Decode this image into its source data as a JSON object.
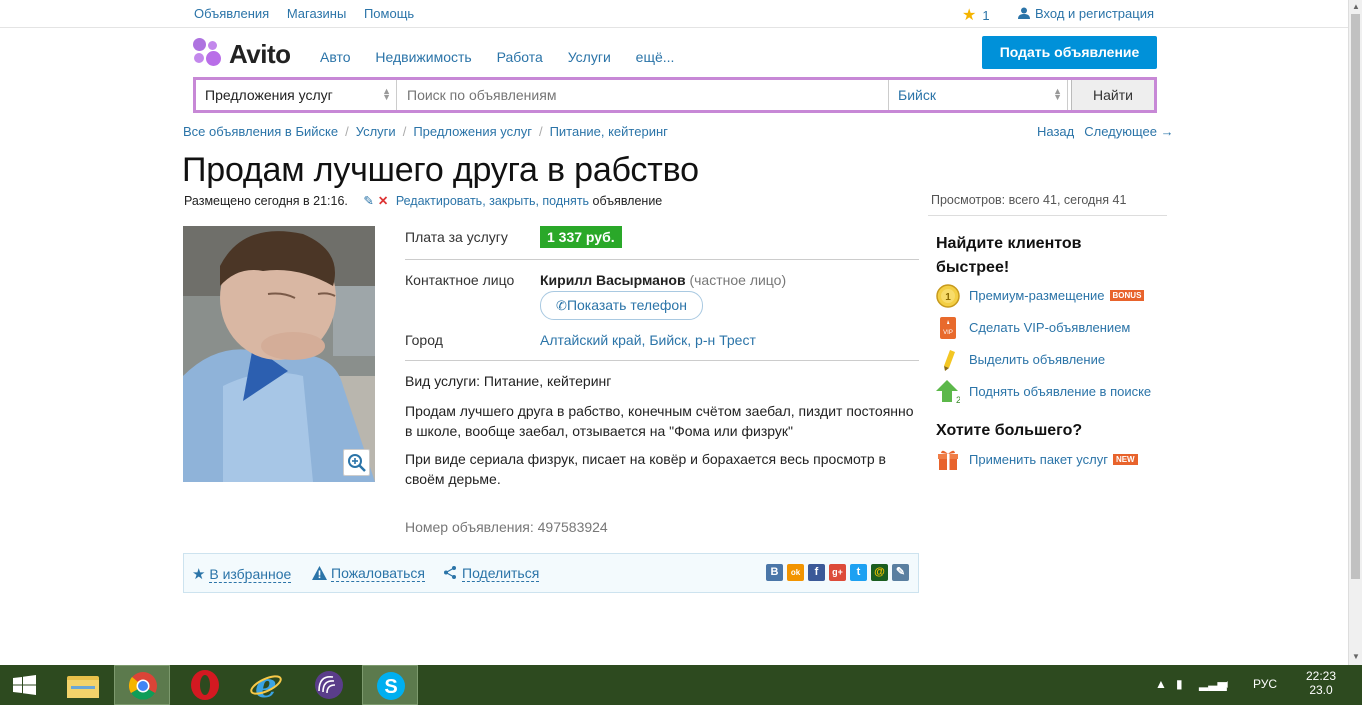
{
  "topbar": {
    "nav": [
      "Объявления",
      "Магазины",
      "Помощь"
    ],
    "fav_count": "1",
    "login": "Вход и регистрация"
  },
  "header": {
    "logo_text": "Avito",
    "nav": [
      "Авто",
      "Недвижимость",
      "Работа",
      "Услуги",
      "ещё..."
    ],
    "post_button": "Подать объявление"
  },
  "search": {
    "category": "Предложения услуг",
    "placeholder": "Поиск по объявлениям",
    "city": "Бийск",
    "button": "Найти"
  },
  "breadcrumbs": [
    "Все объявления в Бийске",
    "Услуги",
    "Предложения услуг",
    "Питание, кейтеринг"
  ],
  "pager": {
    "prev": "Назад",
    "next": "Следующее →"
  },
  "listing": {
    "title": "Продам лучшего друга в рабство",
    "posted": "Размещено сегодня в 21:16.",
    "edit_links": "Редактировать, закрыть, поднять",
    "edit_suffix": "объявление",
    "views": "Просмотров: всего 41, сегодня 41",
    "price_label": "Плата за услугу",
    "price": "1 337 руб.",
    "contact_label": "Контактное лицо",
    "contact_name": "Кирилл Васырманов",
    "contact_type": "(частное лицо)",
    "phone_button": "Показать телефон",
    "city_label": "Город",
    "city": "Алтайский край, Бийск, р-н Трест",
    "service_type": "Вид услуги: Питание, кейтеринг",
    "description_1": "Продам лучшего друга в рабство, конечным счётом заебал, пиздит постоянно в школе, вообще заебал, отзывается на \"Фома или физрук\"",
    "description_2": "При виде сериала физрук, писает на ковёр и борахается весь просмотр в своём дерьме.",
    "ad_number": "Номер объявления: 497583924"
  },
  "actions": {
    "favorite": "В избранное",
    "complain": "Пожаловаться",
    "share": "Поделиться",
    "social": [
      {
        "name": "vk",
        "glyph": "B",
        "color": "#4a76a8"
      },
      {
        "name": "odnoklassniki",
        "glyph": "ok",
        "color": "#f29400"
      },
      {
        "name": "facebook",
        "glyph": "f",
        "color": "#3b5998"
      },
      {
        "name": "google-plus",
        "glyph": "g+",
        "color": "#dd4b39"
      },
      {
        "name": "twitter",
        "glyph": "t",
        "color": "#1da1f2"
      },
      {
        "name": "mail",
        "glyph": "@",
        "color": "#1b5e20"
      },
      {
        "name": "livejournal",
        "glyph": "✎",
        "color": "#5a7fa0"
      }
    ]
  },
  "sidebar": {
    "heading1": "Найдите клиентов быстрее!",
    "items": [
      {
        "label": "Премиум-размещение",
        "badge": "BONUS"
      },
      {
        "label": "Сделать VIP-объявлением",
        "badge": ""
      },
      {
        "label": "Выделить объявление",
        "badge": ""
      },
      {
        "label": "Поднять объявление в поиске",
        "badge": ""
      }
    ],
    "heading2": "Хотите большего?",
    "package": {
      "label": "Применить пакет услуг",
      "badge": "NEW"
    }
  },
  "taskbar": {
    "lang": "РУС",
    "time": "22:23",
    "date": "23.0"
  },
  "colors": {
    "link": "#2b74a8",
    "accent_button": "#0091d9",
    "search_border": "#c788d6",
    "price_bg": "#2aa829",
    "taskbar": "#2d4a1f"
  }
}
